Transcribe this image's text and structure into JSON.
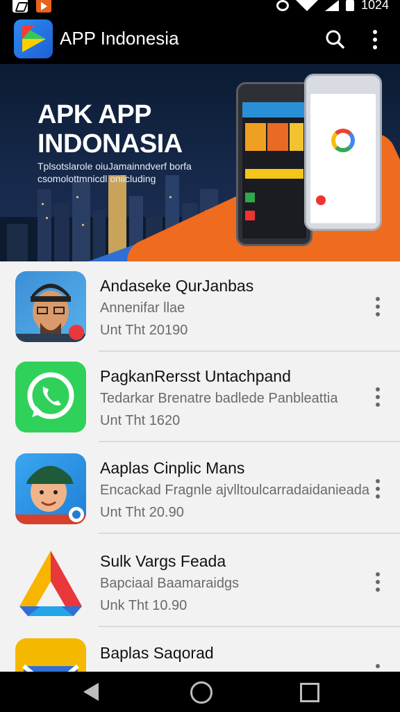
{
  "status_bar": {
    "time": "1024"
  },
  "app_bar": {
    "title": "APP Indonesia",
    "search_icon": "search-icon",
    "menu_icon": "more-vert-icon"
  },
  "banner": {
    "title": "APK APP INDONASIA",
    "subtitle": "Tplsotslarole oiuJamainndverf borfa csomolottmnicdl oniicluding"
  },
  "apps": [
    {
      "title": "Andaseke QurJanbas",
      "subtitle": "Annenifar llae",
      "meta": "Unt  Tht  20190",
      "icon": "avatar-cap-man-icon"
    },
    {
      "title": "PagkanRersst Untachpand",
      "subtitle": "Tedarkar Brenatre badlede Panbleattia",
      "meta": "Unt  Tht  1620",
      "icon": "whatsapp-icon"
    },
    {
      "title": "Aaplas Cinplic Mans",
      "subtitle": "Encackad Fragnle ajvlltoulcarradaidanieada",
      "meta": "Unt  Tht  20.90",
      "icon": "avatar-cartoon-icon"
    },
    {
      "title": "Sulk Vargs Feada",
      "subtitle": "Bapciaal Baamaraidgs",
      "meta": "Unk  Tht  10.90",
      "icon": "drive-triangle-icon"
    },
    {
      "title": "Baplas Saqorad",
      "subtitle": "",
      "meta": "",
      "icon": "mail-icon"
    }
  ],
  "nav_bar": {
    "back": "back-icon",
    "home": "home-icon",
    "recents": "recents-icon"
  }
}
